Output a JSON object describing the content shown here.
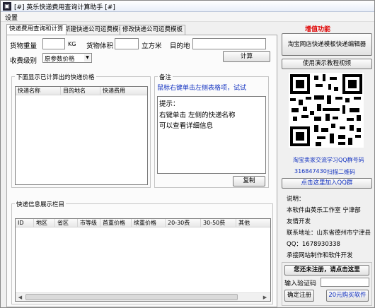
{
  "window": {
    "title": "[#] 英乐快递费用查询计算助手 [#]"
  },
  "menu": {
    "settings": "设置"
  },
  "tabs": [
    {
      "label": "快递费用查询和计算"
    },
    {
      "label": "新建快递公司运费模板"
    },
    {
      "label": "修改快递公司运费模板"
    }
  ],
  "form": {
    "weight_label": "货物重量",
    "weight_unit": "KG",
    "volume_label": "货物体积",
    "volume_unit": "立方米",
    "dest_label": "目的地",
    "calc_button": "计算",
    "fee_level_label": "收费级别",
    "fee_level_value": "原参数价格"
  },
  "results": {
    "group_title": "下面显示已计算出的快递价格",
    "columns": [
      "快递名称",
      "目的地名",
      "快递费用"
    ]
  },
  "notes": {
    "group_title": "备注",
    "hint": "鼠标右键单击左侧表格项，试试",
    "lines": [
      "提示：",
      "右键单击  左侧的快递名称",
      "可以查看详细信息"
    ],
    "copy_button": "复制"
  },
  "info_panel": {
    "group_title": "快递信息展示栏目",
    "columns": [
      "ID",
      "地区",
      "省区",
      "市等级",
      "首重价格",
      "续重价格",
      "20-30费",
      "30-50费",
      "其他"
    ]
  },
  "side": {
    "feature_title": "增值功能",
    "editor_button": "淘宝网店快递模板快递编辑器",
    "video_button": "使用演示教程视频",
    "qq_group_label": "淘宝卖家交流学习QQ群号码",
    "qq_group_number": "316847430",
    "scan_label": "扫描二维码",
    "join_button": "点击这里加入QQ群",
    "about_lines": [
      "说明：",
      "本软件由英乐工作室 宁津部",
      "友情开发",
      "联系地址：山东省德州市宁津县",
      "QQ：1678930338",
      "承接网站制作和软件开发"
    ],
    "register_prompt": "您还未注册，请点击这里",
    "verify_label": "输入验证码",
    "confirm_button": "确定注册",
    "buy_button": "20元购买软件"
  },
  "colors": {
    "accent_blue": "#1030c0",
    "accent_red": "#e00000"
  }
}
